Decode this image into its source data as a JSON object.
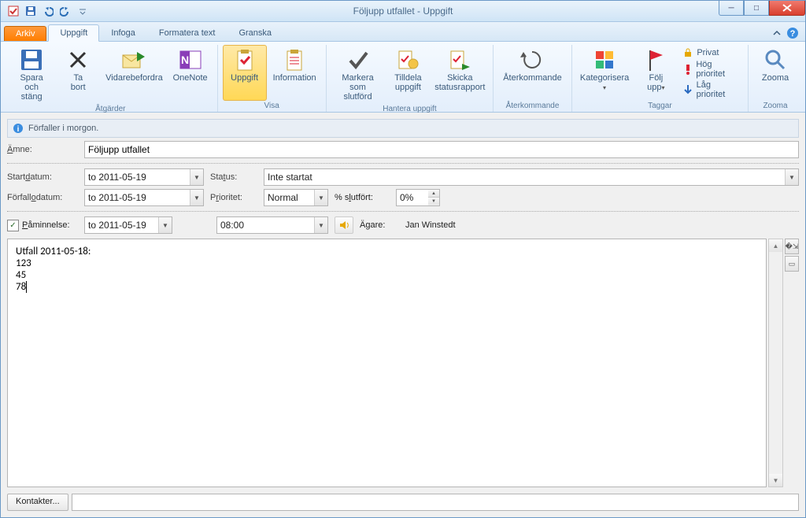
{
  "window": {
    "title": "Följupp utfallet  -  Uppgift"
  },
  "qat": {
    "items": [
      "checkbox-icon",
      "save-icon",
      "undo-icon",
      "redo-icon",
      "dropdown-icon"
    ]
  },
  "tabs": {
    "file": "Arkiv",
    "items": [
      {
        "label": "Uppgift",
        "active": true
      },
      {
        "label": "Infoga",
        "active": false
      },
      {
        "label": "Formatera text",
        "active": false
      },
      {
        "label": "Granska",
        "active": false
      }
    ]
  },
  "ribbon": {
    "groups": [
      {
        "name": "actions",
        "label": "Åtgärder",
        "buttons": [
          {
            "label": "Spara\noch stäng",
            "icon": "save-close-icon"
          },
          {
            "label": "Ta\nbort",
            "icon": "delete-icon"
          },
          {
            "label": "Vidarebefordra",
            "icon": "forward-icon"
          },
          {
            "label": "OneNote",
            "icon": "onenote-icon"
          }
        ]
      },
      {
        "name": "show",
        "label": "Visa",
        "buttons": [
          {
            "label": "Uppgift",
            "icon": "task-icon",
            "active": true
          },
          {
            "label": "Information",
            "icon": "details-icon"
          }
        ]
      },
      {
        "name": "manage",
        "label": "Hantera uppgift",
        "buttons": [
          {
            "label": "Markera\nsom slutförd",
            "icon": "complete-icon"
          },
          {
            "label": "Tilldela\nuppgift",
            "icon": "assign-icon"
          },
          {
            "label": "Skicka\nstatusrapport",
            "icon": "report-icon"
          }
        ]
      },
      {
        "name": "recurrence",
        "label": "Återkommande",
        "buttons": [
          {
            "label": "Återkommande",
            "icon": "recur-icon"
          }
        ]
      },
      {
        "name": "tags",
        "label": "Taggar",
        "buttons": [
          {
            "label": "Kategorisera\n",
            "icon": "categorize-icon",
            "dropdown": true
          },
          {
            "label": "Följ\nupp",
            "icon": "followup-icon",
            "dropdown": true
          }
        ],
        "small": [
          {
            "label": "Privat",
            "icon": "lock-icon"
          },
          {
            "label": "Hög prioritet",
            "icon": "high-priority-icon"
          },
          {
            "label": "Låg prioritet",
            "icon": "low-priority-icon"
          }
        ]
      },
      {
        "name": "zoom",
        "label": "Zooma",
        "buttons": [
          {
            "label": "Zooma",
            "icon": "zoom-icon"
          }
        ]
      }
    ]
  },
  "infobar": {
    "text": "Förfaller i morgon."
  },
  "form": {
    "subject_label": "Ämne:",
    "subject_value": "Följupp utfallet",
    "startdate_label": "Startdatum:",
    "startdate_value": "to 2011-05-19",
    "status_label": "Status:",
    "status_value": "Inte startat",
    "duedate_label": "Förfallodatum:",
    "duedate_value": "to 2011-05-19",
    "priority_label": "Prioritet:",
    "priority_value": "Normal",
    "pct_label": "% slutfört:",
    "pct_value": "0%",
    "reminder_label": "Påminnelse:",
    "reminder_checked": true,
    "reminder_date": "to 2011-05-19",
    "reminder_time": "08:00",
    "owner_label": "Ägare:",
    "owner_value": "Jan Winstedt"
  },
  "body": {
    "lines": [
      "Utfall 2011-05-18:",
      "",
      "123",
      "45",
      "78"
    ]
  },
  "bottom": {
    "contacts_label": "Kontakter..."
  }
}
